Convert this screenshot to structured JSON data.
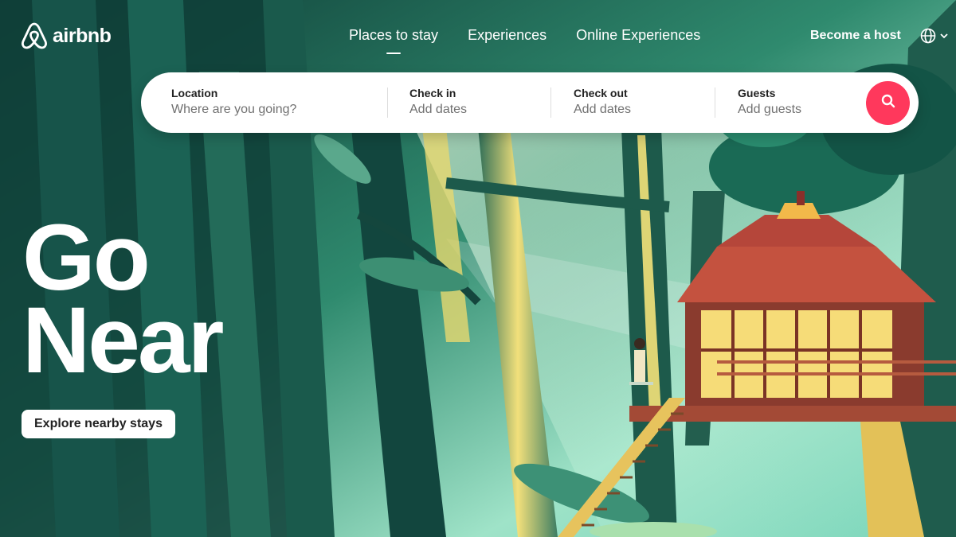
{
  "brand": {
    "name": "airbnb",
    "logo_icon": "airbnb-belo-icon"
  },
  "nav": {
    "items": [
      {
        "label": "Places to stay",
        "active": true
      },
      {
        "label": "Experiences",
        "active": false
      },
      {
        "label": "Online Experiences",
        "active": false
      }
    ],
    "host_label": "Become a host",
    "language_icon": "globe-icon",
    "dropdown_icon": "chevron-down-icon"
  },
  "search": {
    "location": {
      "label": "Location",
      "placeholder": "Where are you going?"
    },
    "check_in": {
      "label": "Check in",
      "value": "Add dates"
    },
    "check_out": {
      "label": "Check out",
      "value": "Add dates"
    },
    "guests": {
      "label": "Guests",
      "value": "Add guests"
    },
    "button_icon": "search-icon"
  },
  "hero": {
    "headline_line1": "Go",
    "headline_line2": "Near",
    "cta_label": "Explore nearby stays"
  },
  "colors": {
    "accent": "#ff385c",
    "text_primary": "#222222",
    "text_secondary": "#717171"
  }
}
